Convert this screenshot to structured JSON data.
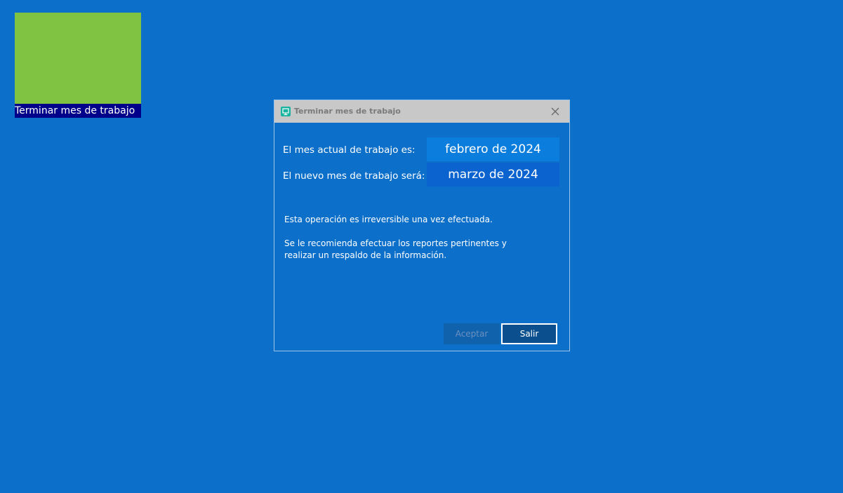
{
  "desktop": {
    "tile": {
      "label": "Terminar mes de trabajo"
    }
  },
  "dialog": {
    "title": "Terminar mes de trabajo",
    "current_label": "El mes actual de trabajo es:",
    "current_value": "febrero de 2024",
    "new_label": "El nuevo mes de trabajo será:",
    "new_value": "marzo de 2024",
    "message_line1": "Esta operación es irreversible una vez efectuada.",
    "message_line2": "Se le recomienda efectuar los reportes pertinentes y",
    "message_line3": "realizar un respaldo de la información.",
    "accept_label": "Aceptar",
    "exit_label": "Salir",
    "icons": {
      "app": "monitor-icon",
      "close": "close-icon"
    }
  },
  "colors": {
    "desktop_background": "#0c6fc9",
    "tile_face": "#80c342",
    "tile_label_bg": "#00008b",
    "titlebar": "#c8c8c8"
  }
}
